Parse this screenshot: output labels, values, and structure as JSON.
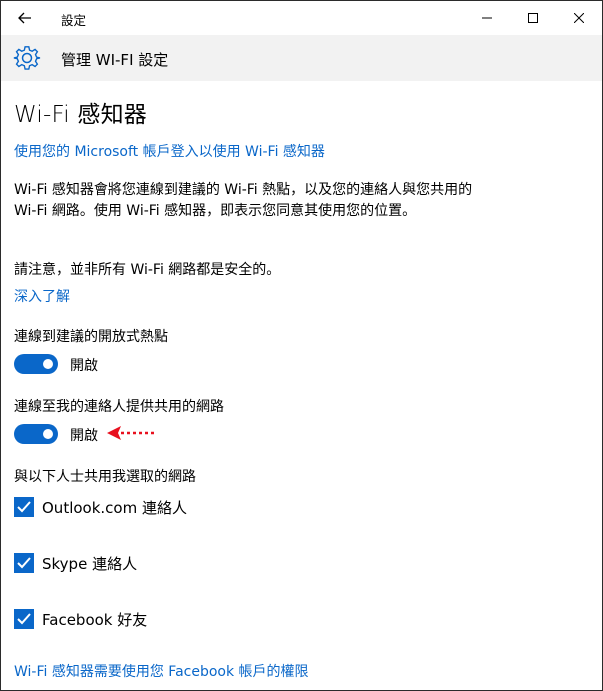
{
  "window": {
    "title": "設定"
  },
  "header": {
    "title": "管理 WI-FI 設定",
    "icon": "gear-icon"
  },
  "page": {
    "title": "Wi-Fi 感知器",
    "signin_link": "使用您的 Microsoft 帳戶登入以使用 Wi-Fi 感知器",
    "description": "Wi-Fi 感知器會將您連線到建議的 Wi-Fi 熱點，以及您的連絡人與您共用的 Wi-Fi 網路。使用 Wi-Fi 感知器，即表示您同意其使用您的位置。",
    "note": "請注意，並非所有 Wi-Fi 網路都是安全的。",
    "learn_more": "深入了解",
    "open_hotspots_label": "連線到建議的開放式熱點",
    "open_hotspots_state": "開啟",
    "contacts_networks_label": "連線至我的連絡人提供共用的網路",
    "contacts_networks_state": "開啟",
    "share_label": "與以下人士共用我選取的網路",
    "share_options": [
      {
        "label": "Outlook.com 連絡人",
        "checked": true
      },
      {
        "label": "Skype 連絡人",
        "checked": true
      },
      {
        "label": "Facebook 好友",
        "checked": true
      }
    ],
    "facebook_permission_link": "Wi-Fi 感知器需要使用您 Facebook 帳戶的權限"
  },
  "colors": {
    "accent": "#0a67c9",
    "header_bg": "#f2f2f2",
    "annotation_arrow": "#e8101e"
  }
}
